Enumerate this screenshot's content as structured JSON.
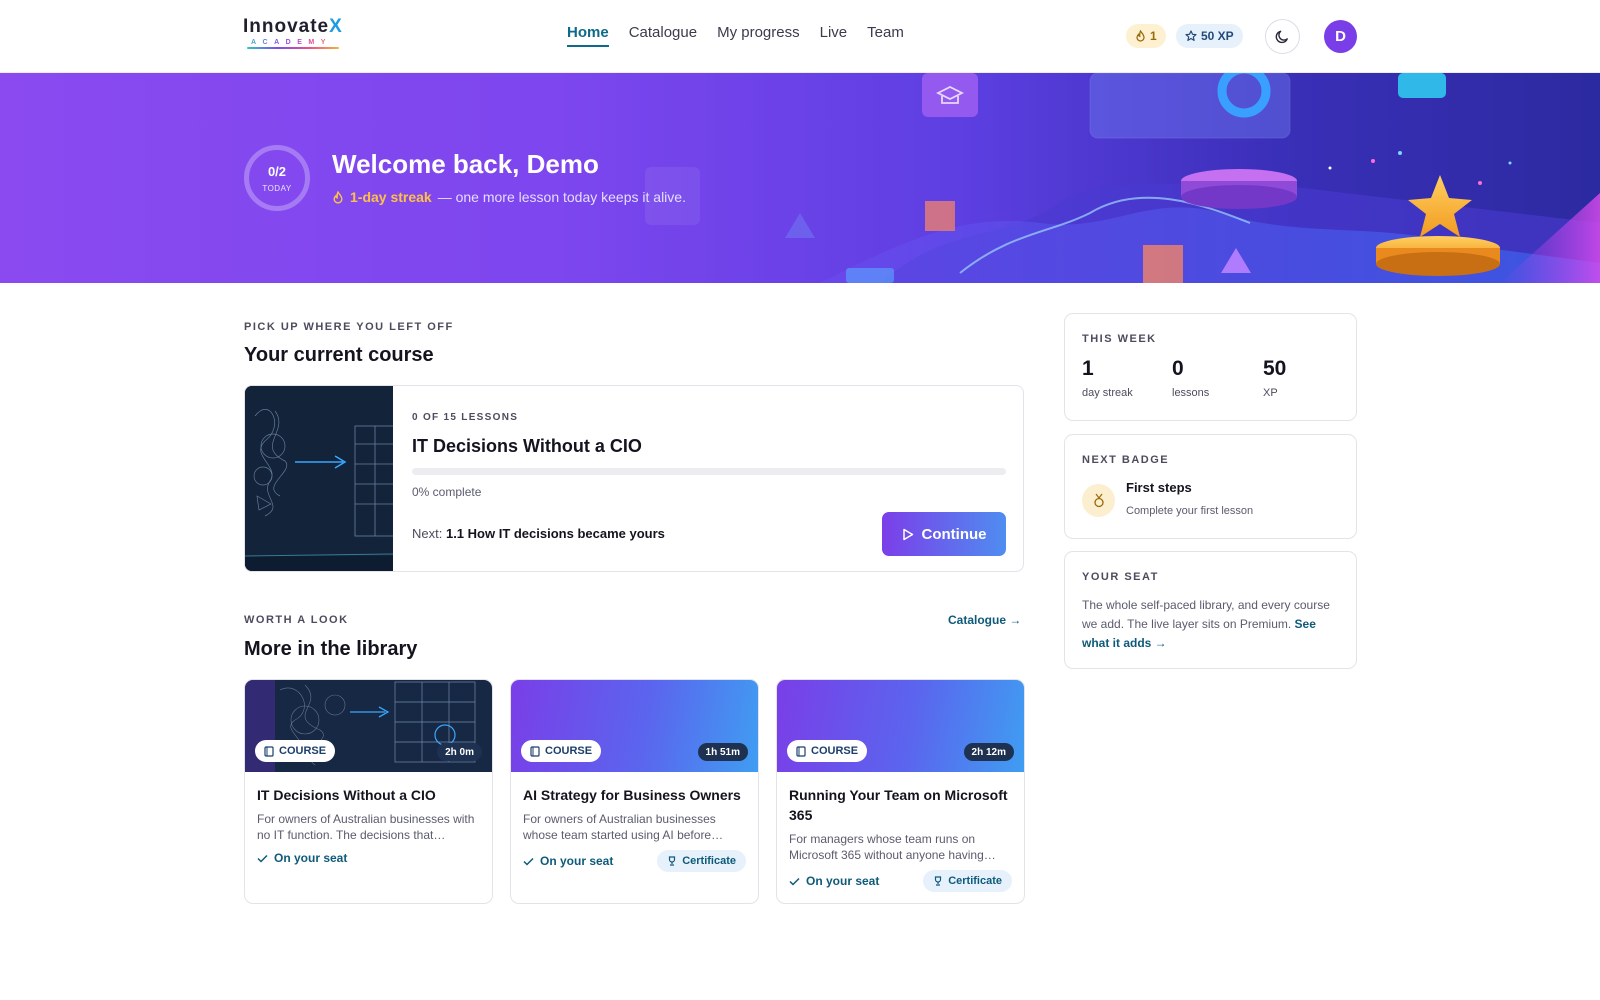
{
  "brand": {
    "name_main": "Innovate",
    "name_x": "X",
    "name_sub": "ACADEMY"
  },
  "nav": {
    "items": [
      {
        "label": "Home",
        "active": true
      },
      {
        "label": "Catalogue"
      },
      {
        "label": "My progress"
      },
      {
        "label": "Live"
      },
      {
        "label": "Team"
      }
    ]
  },
  "header": {
    "streak_count": "1",
    "xp_label": "50 XP",
    "avatar_initial": "D",
    "theme_icon": "moon-icon"
  },
  "hero": {
    "ring_value": "0/2",
    "ring_label": "TODAY",
    "title": "Welcome back, Demo",
    "streak_text": "1-day streak",
    "streak_suffix": "— one more lesson today keeps it alive."
  },
  "current": {
    "eyebrow": "PICK UP WHERE YOU LEFT OFF",
    "title": "Your current course",
    "course": {
      "meta": "0 OF 15 LESSONS",
      "title": "IT Decisions Without a CIO",
      "progress": 0,
      "progress_text": "0% complete",
      "next_prefix": "Next:",
      "next_lesson": "1.1 How IT decisions became yours",
      "continue_label": "Continue"
    }
  },
  "library": {
    "eyebrow": "WORTH A LOOK",
    "title": "More in the library",
    "catalogue_link": "Catalogue →",
    "cards": [
      {
        "tag": "COURSE",
        "duration": "2h 0m",
        "title": "IT Decisions Without a CIO",
        "desc": "For owners of Australian businesses with no IT function. The decisions that…",
        "seat": "On your seat",
        "cert": ""
      },
      {
        "tag": "COURSE",
        "duration": "1h 51m",
        "title": "AI Strategy for Business Owners",
        "desc": "For owners of Australian businesses whose team started using AI before…",
        "seat": "On your seat",
        "cert": "Certificate"
      },
      {
        "tag": "COURSE",
        "duration": "2h 12m",
        "title": "Running Your Team on Microsoft 365",
        "desc": "For managers whose team runs on Microsoft 365 without anyone having…",
        "seat": "On your seat",
        "cert": "Certificate"
      }
    ]
  },
  "sidebar": {
    "week": {
      "eyebrow": "THIS WEEK",
      "stats": [
        {
          "value": "1",
          "label": "day streak"
        },
        {
          "value": "0",
          "label": "lessons"
        },
        {
          "value": "50",
          "label": "XP"
        }
      ]
    },
    "badge": {
      "eyebrow": "NEXT BADGE",
      "title": "First steps",
      "desc": "Complete your first lesson"
    },
    "seat": {
      "eyebrow": "YOUR SEAT",
      "text": "The whole self-paced library, and every course we add. The live layer sits on Premium.",
      "link": "See what it adds →"
    }
  },
  "colors": {
    "accent": "#7a3ee8",
    "link": "#0e5a7a",
    "streak": "#ffc145"
  }
}
